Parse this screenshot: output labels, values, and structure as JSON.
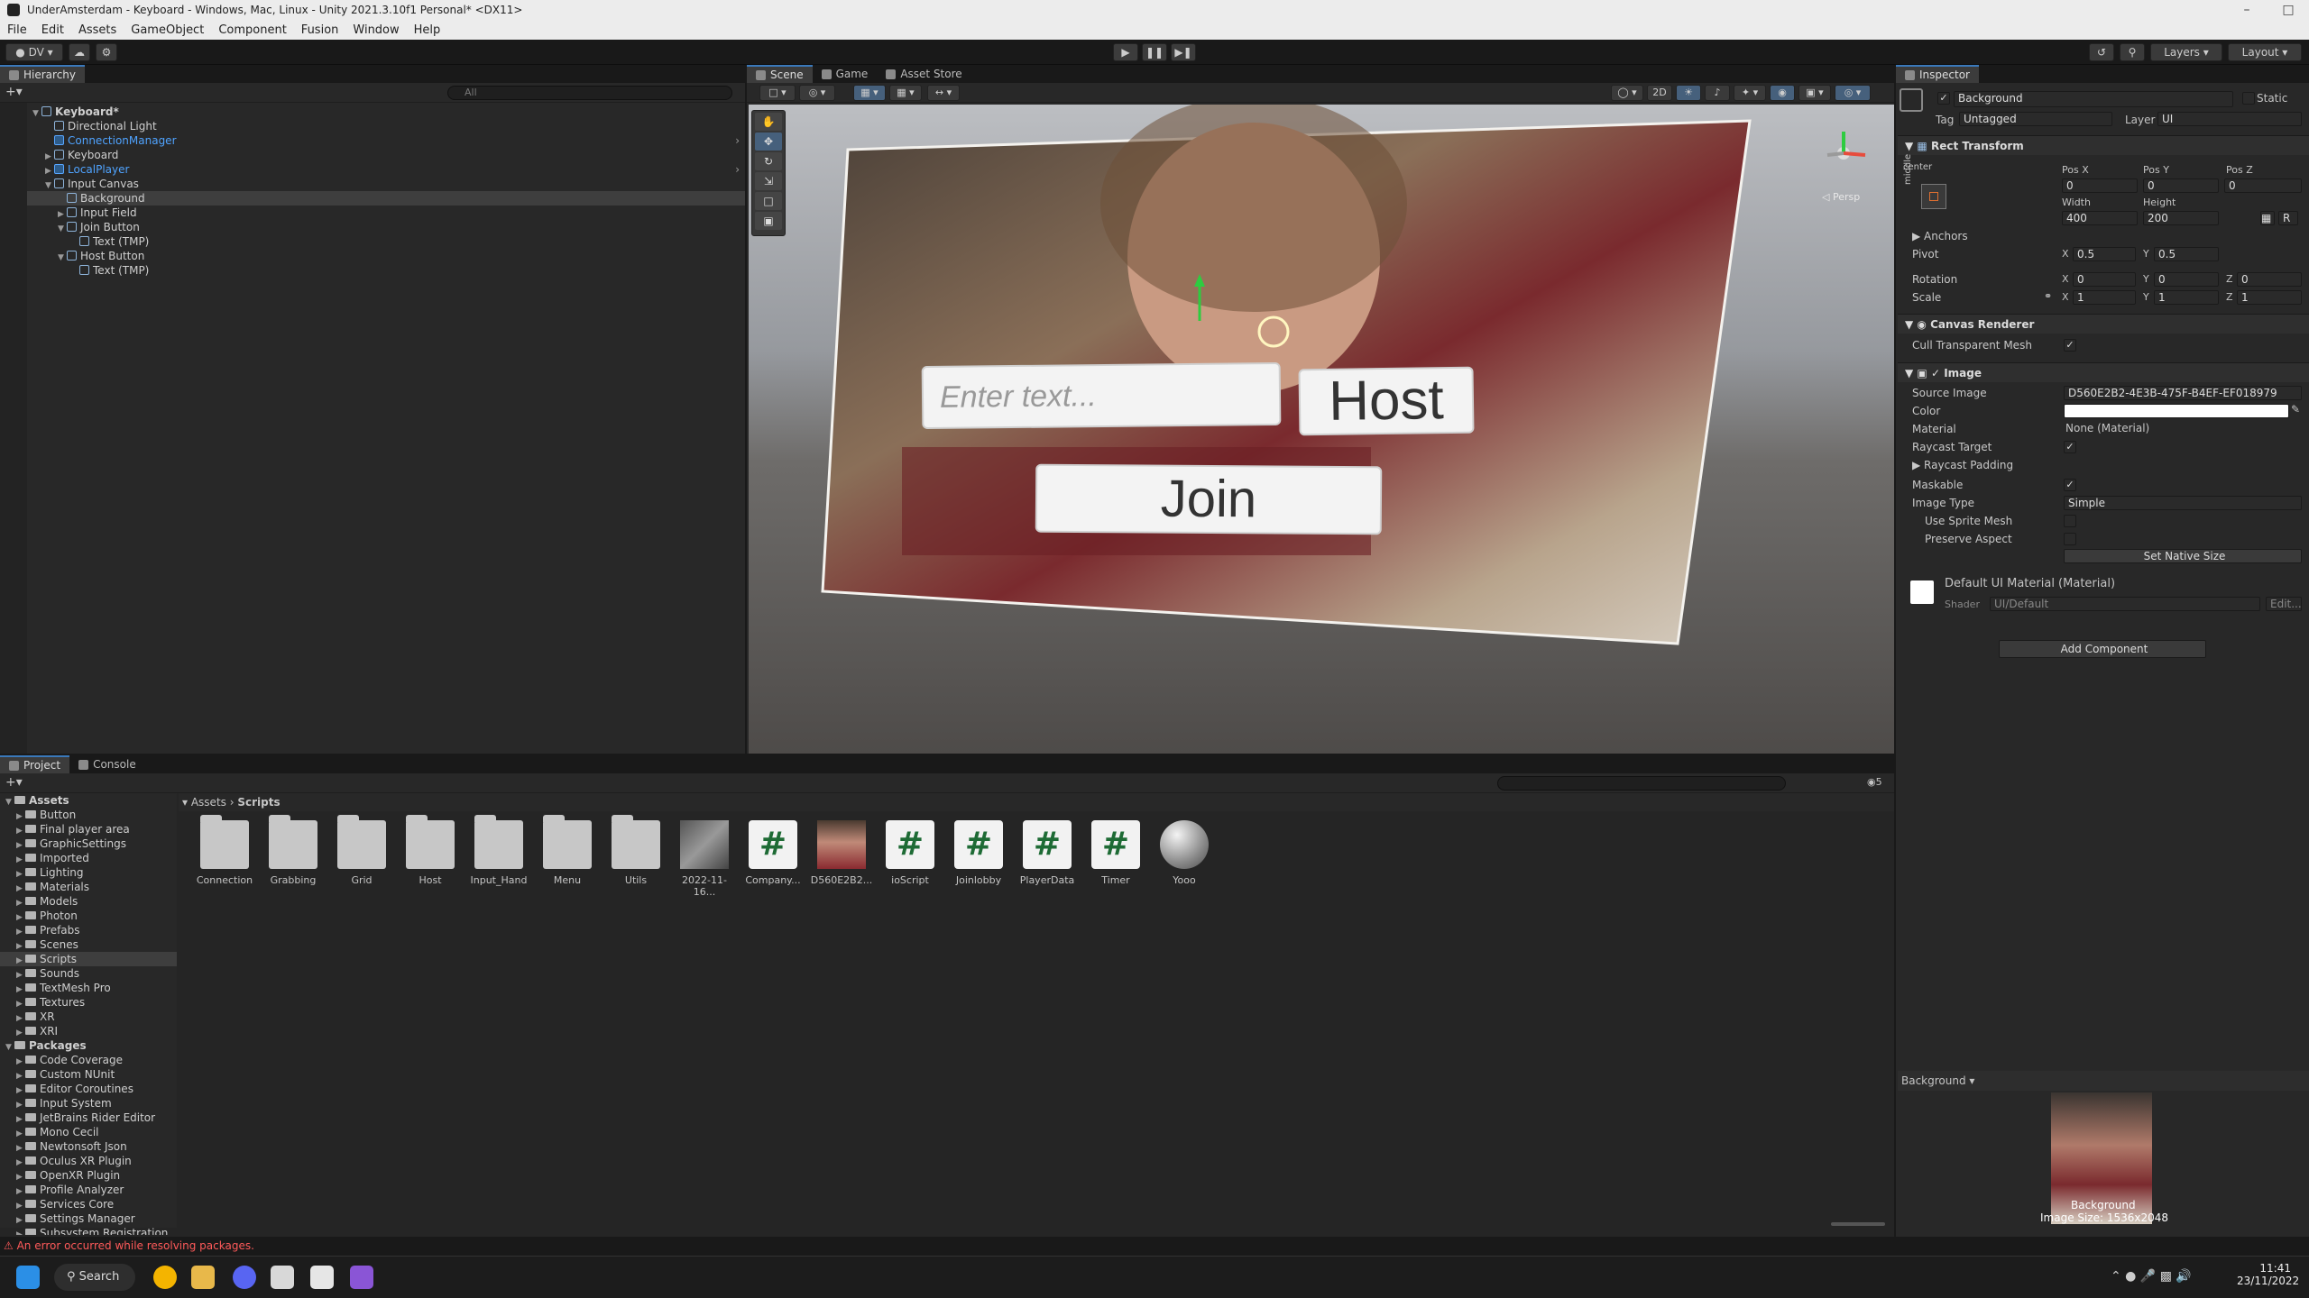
{
  "window": {
    "title": "UnderAmsterdam - Keyboard - Windows, Mac, Linux - Unity 2021.3.10f1 Personal* <DX11>"
  },
  "menu": [
    "File",
    "Edit",
    "Assets",
    "GameObject",
    "Component",
    "Fusion",
    "Window",
    "Help"
  ],
  "toolbar": {
    "account": "DV",
    "layers": "Layers",
    "layout": "Layout"
  },
  "hierarchy": {
    "tab": "Hierarchy",
    "search_placeholder": "All",
    "rows": [
      "Keyboard*",
      "Directional Light",
      "ConnectionManager",
      "Keyboard",
      "LocalPlayer",
      "Input Canvas",
      "Background",
      "Input Field",
      "Join Button",
      "Text (TMP)",
      "Host Button",
      "Text (TMP)"
    ]
  },
  "scene": {
    "tabs": [
      "Scene",
      "Game",
      "Asset Store"
    ],
    "toggle_2d": "2D",
    "persp_label": "◁ Persp",
    "overlay": {
      "input_placeholder": "Enter text...",
      "host_button": "Host",
      "join_button": "Join"
    }
  },
  "inspector": {
    "tab": "Inspector",
    "object_name": "Background",
    "static_label": "Static",
    "tag_label": "Tag",
    "tag_value": "Untagged",
    "layer_label": "Layer",
    "layer_value": "UI",
    "rect_transform": {
      "title": "Rect Transform",
      "anchor_label": "center",
      "side_label": "middle",
      "posx_label": "Pos X",
      "posy_label": "Pos Y",
      "posz_label": "Pos Z",
      "posx": "0",
      "posy": "0",
      "posz": "0",
      "width_label": "Width",
      "height_label": "Height",
      "width": "400",
      "height": "200",
      "r_button": "R",
      "anchors_label": "Anchors",
      "pivot_label": "Pivot",
      "pivot_x": "0.5",
      "pivot_y": "0.5",
      "rotation_label": "Rotation",
      "rot_x": "0",
      "rot_y": "0",
      "rot_z": "0",
      "scale_label": "Scale",
      "scale_x": "1",
      "scale_y": "1",
      "scale_z": "1",
      "x": "X",
      "y": "Y",
      "z": "Z"
    },
    "canvas_renderer": {
      "title": "Canvas Renderer",
      "cull_label": "Cull Transparent Mesh"
    },
    "image": {
      "title": "Image",
      "source_image_label": "Source Image",
      "source_image": "D560E2B2-4E3B-475F-B4EF-EF018979",
      "color_label": "Color",
      "material_label": "Material",
      "material": "None (Material)",
      "raycast_target_label": "Raycast Target",
      "raycast_padding_label": "Raycast Padding",
      "maskable_label": "Maskable",
      "image_type_label": "Image Type",
      "image_type": "Simple",
      "use_sprite_mesh_label": "Use Sprite Mesh",
      "preserve_aspect_label": "Preserve Aspect",
      "native_size_button": "Set Native Size"
    },
    "material": {
      "title": "Default UI Material (Material)",
      "shader_label": "Shader",
      "shader": "UI/Default",
      "edit_button": "Edit..."
    },
    "add_component": "Add Component",
    "preview": {
      "dropdown": "Background ▾",
      "caption": "Background",
      "size_text": "Image Size: 1536x2048"
    }
  },
  "project": {
    "tabs": [
      "Project",
      "Console"
    ],
    "breadcrumb": [
      "Assets",
      "Scripts"
    ],
    "count_badge": "5",
    "tree": [
      {
        "label": "Assets",
        "level": 0,
        "bold": true
      },
      {
        "label": "Button",
        "level": 1
      },
      {
        "label": "Final player area",
        "level": 1
      },
      {
        "label": "GraphicSettings",
        "level": 1
      },
      {
        "label": "Imported",
        "level": 1
      },
      {
        "label": "Lighting",
        "level": 1
      },
      {
        "label": "Materials",
        "level": 1
      },
      {
        "label": "Models",
        "level": 1
      },
      {
        "label": "Photon",
        "level": 1
      },
      {
        "label": "Prefabs",
        "level": 1
      },
      {
        "label": "Scenes",
        "level": 1
      },
      {
        "label": "Scripts",
        "level": 1,
        "selected": true
      },
      {
        "label": "Sounds",
        "level": 1
      },
      {
        "label": "TextMesh Pro",
        "level": 1
      },
      {
        "label": "Textures",
        "level": 1
      },
      {
        "label": "XR",
        "level": 1
      },
      {
        "label": "XRI",
        "level": 1
      },
      {
        "label": "Packages",
        "level": 0,
        "bold": true
      },
      {
        "label": "Code Coverage",
        "level": 1
      },
      {
        "label": "Custom NUnit",
        "level": 1
      },
      {
        "label": "Editor Coroutines",
        "level": 1
      },
      {
        "label": "Input System",
        "level": 1
      },
      {
        "label": "JetBrains Rider Editor",
        "level": 1
      },
      {
        "label": "Mono Cecil",
        "level": 1
      },
      {
        "label": "Newtonsoft Json",
        "level": 1
      },
      {
        "label": "Oculus XR Plugin",
        "level": 1
      },
      {
        "label": "OpenXR Plugin",
        "level": 1
      },
      {
        "label": "Profile Analyzer",
        "level": 1
      },
      {
        "label": "Services Core",
        "level": 1
      },
      {
        "label": "Settings Manager",
        "level": 1
      },
      {
        "label": "Subsystem Registration",
        "level": 1
      }
    ],
    "assets": [
      {
        "label": "Connection",
        "kind": "folder"
      },
      {
        "label": "Grabbing",
        "kind": "folder"
      },
      {
        "label": "Grid",
        "kind": "folder"
      },
      {
        "label": "Host",
        "kind": "folder"
      },
      {
        "label": "Input_Hand",
        "kind": "folder"
      },
      {
        "label": "Menu",
        "kind": "folder"
      },
      {
        "label": "Utils",
        "kind": "folder"
      },
      {
        "label": "2022-11-16...",
        "kind": "image"
      },
      {
        "label": "Company...",
        "kind": "script"
      },
      {
        "label": "D560E2B2...",
        "kind": "photo"
      },
      {
        "label": "ioScript",
        "kind": "script"
      },
      {
        "label": "Joinlobby",
        "kind": "script"
      },
      {
        "label": "PlayerData",
        "kind": "script"
      },
      {
        "label": "Timer",
        "kind": "script"
      },
      {
        "label": "Yooo",
        "kind": "sphere"
      }
    ]
  },
  "status": {
    "error": "An error occurred while resolving packages."
  },
  "taskbar": {
    "search": "Search",
    "time": "11:41",
    "date": "23/11/2022"
  },
  "colors": {
    "accent": "#3a79bb",
    "error": "#ff5a5a",
    "script_hash": "#1e6b35"
  }
}
